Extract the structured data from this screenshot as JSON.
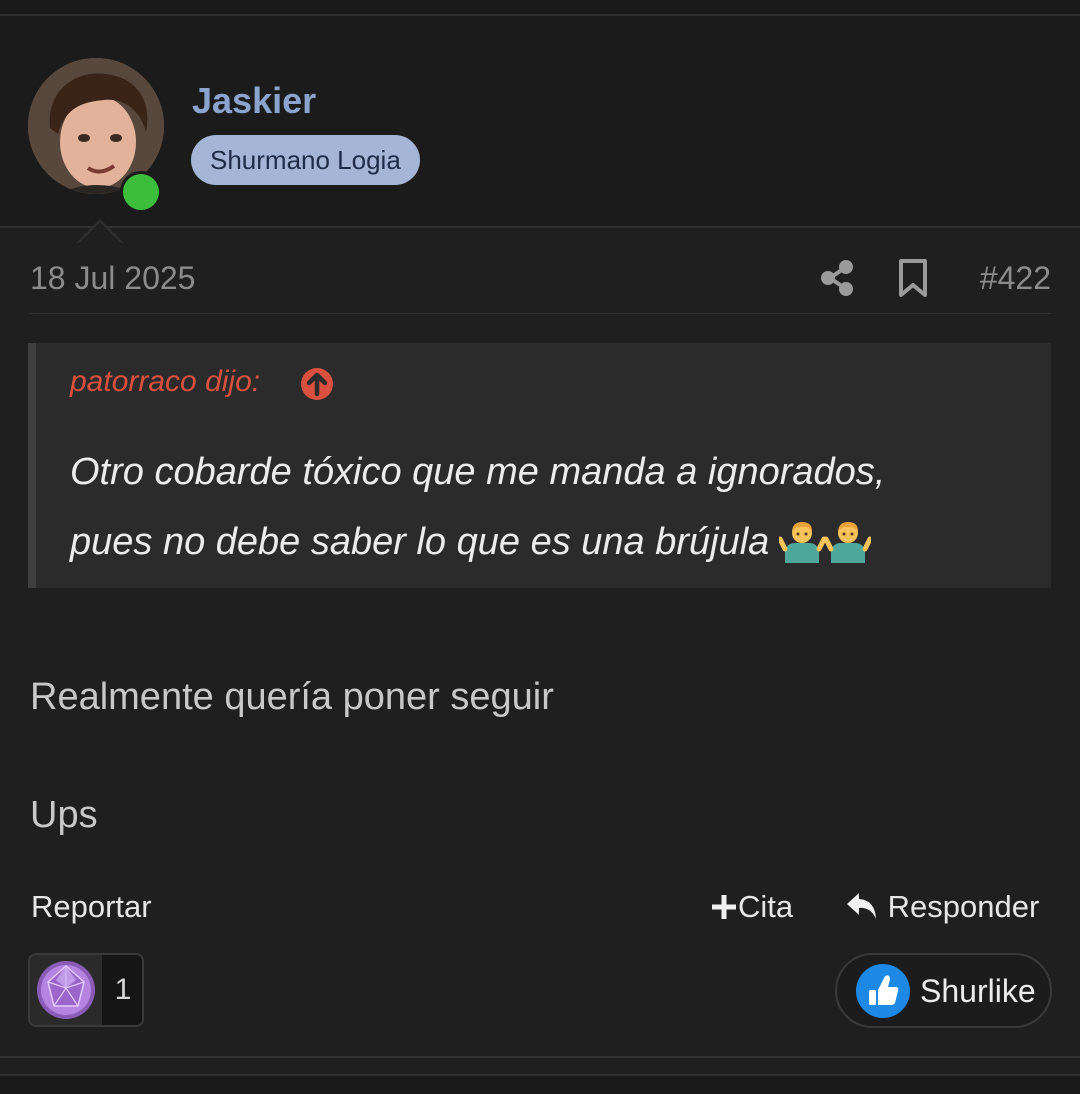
{
  "user": {
    "name": "Jaskier",
    "title": "Shurmano Logia",
    "online": true
  },
  "post": {
    "date": "18 Jul 2025",
    "number": "#422",
    "quote": {
      "author": "patorraco dijo:",
      "line1": "Otro cobarde tóxico que me manda a ignorados,",
      "line2": "pues no debe saber lo que es una brújula",
      "emoji": [
        "man-shrugging-emoji",
        "man-shrugging-emoji"
      ]
    },
    "body": [
      "Realmente quería poner seguir",
      "Ups"
    ]
  },
  "actions": {
    "report": "Reportar",
    "cite": "Cita",
    "reply": "Responder"
  },
  "reactions": {
    "icon": "gem-icon",
    "count": "1",
    "like_label": "Shurlike"
  },
  "colors": {
    "background": "#1f1f1f",
    "username": "#8aa4ce",
    "title_badge": "#a5b5d6",
    "quote_author": "#d9503f",
    "online": "#3cbe3c",
    "like": "#1e88e5"
  }
}
